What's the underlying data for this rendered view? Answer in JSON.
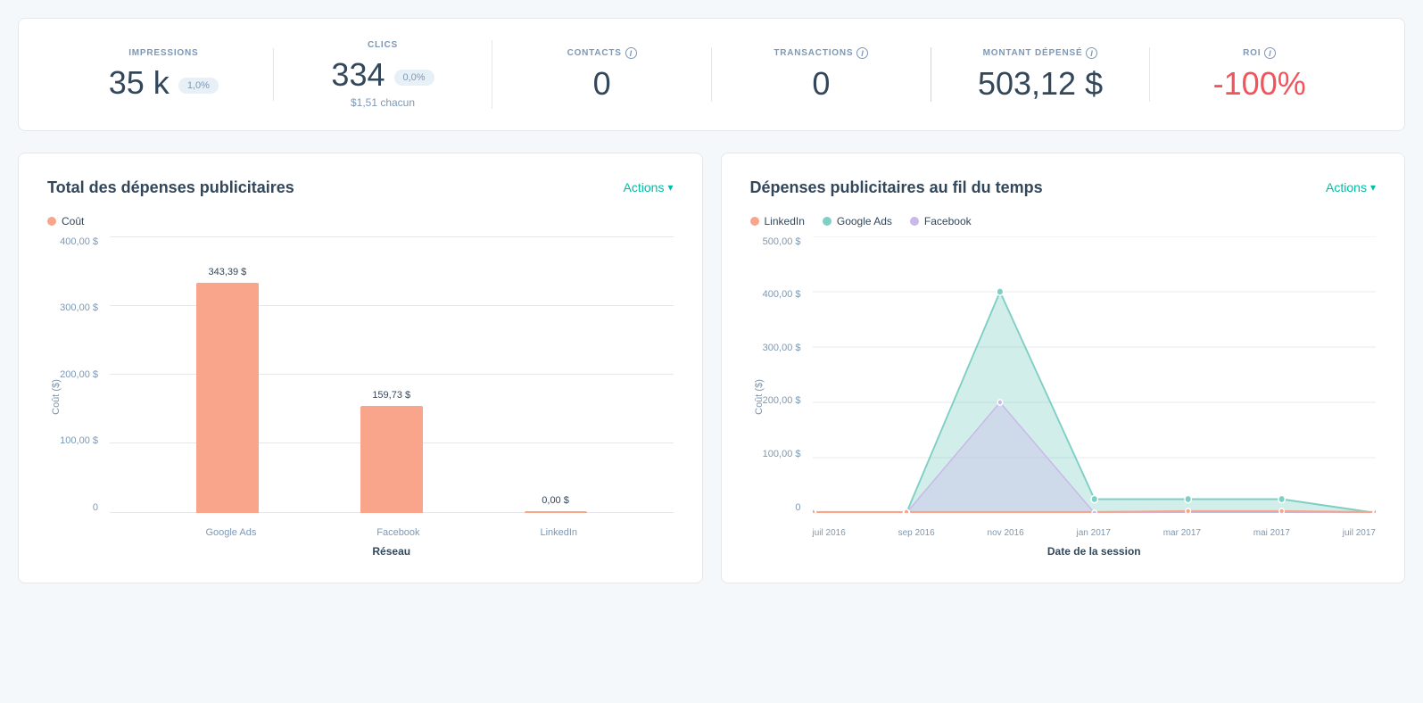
{
  "stats": {
    "impressions": {
      "label": "IMPRESSIONS",
      "value": "35 k",
      "badge": "1,0%"
    },
    "clics": {
      "label": "CLICS",
      "value": "334",
      "badge": "0,0%",
      "sub": "$1,51 chacun"
    },
    "contacts": {
      "label": "CONTACTS",
      "value": "0",
      "has_info": true
    },
    "transactions": {
      "label": "TRANSACTIONS",
      "value": "0",
      "has_info": true
    },
    "montant": {
      "label": "MONTANT DÉPENSÉ",
      "value": "503,12 $",
      "has_info": true
    },
    "roi": {
      "label": "ROI",
      "value": "-100%",
      "has_info": true,
      "red": true
    }
  },
  "chart1": {
    "title": "Total des dépenses publicitaires",
    "actions_label": "Actions",
    "legend": [
      {
        "label": "Coût",
        "color": "#f8a58c"
      }
    ],
    "y_labels": [
      "0",
      "100,00 $",
      "200,00 $",
      "300,00 $",
      "400,00 $"
    ],
    "y_axis_title": "Coût ($)",
    "x_axis_title": "Réseau",
    "bars": [
      {
        "label": "Google Ads",
        "value": "343,39 $",
        "height_pct": 86
      },
      {
        "label": "Facebook",
        "value": "159,73 $",
        "height_pct": 40
      },
      {
        "label": "LinkedIn",
        "value": "0,00 $",
        "height_pct": 0
      }
    ]
  },
  "chart2": {
    "title": "Dépenses publicitaires au fil du temps",
    "actions_label": "Actions",
    "legend": [
      {
        "label": "LinkedIn",
        "color": "#f8a58c"
      },
      {
        "label": "Google Ads",
        "color": "#7ecfc4"
      },
      {
        "label": "Facebook",
        "color": "#c9b8e8"
      }
    ],
    "y_labels": [
      "0",
      "100,00 $",
      "200,00 $",
      "300,00 $",
      "400,00 $",
      "500,00 $"
    ],
    "y_axis_title": "Coût ($)",
    "x_axis_title": "Date de la session",
    "x_labels": [
      "juil 2016",
      "sep 2016",
      "nov 2016",
      "jan 2017",
      "mar 2017",
      "mai 2017",
      "juil 2017"
    ]
  },
  "colors": {
    "accent": "#00bda5",
    "red": "#f2545b",
    "bar_orange": "#f8a58c",
    "line_teal": "#7ecfc4",
    "line_purple": "#c9b8e8",
    "line_orange": "#f8a58c"
  }
}
